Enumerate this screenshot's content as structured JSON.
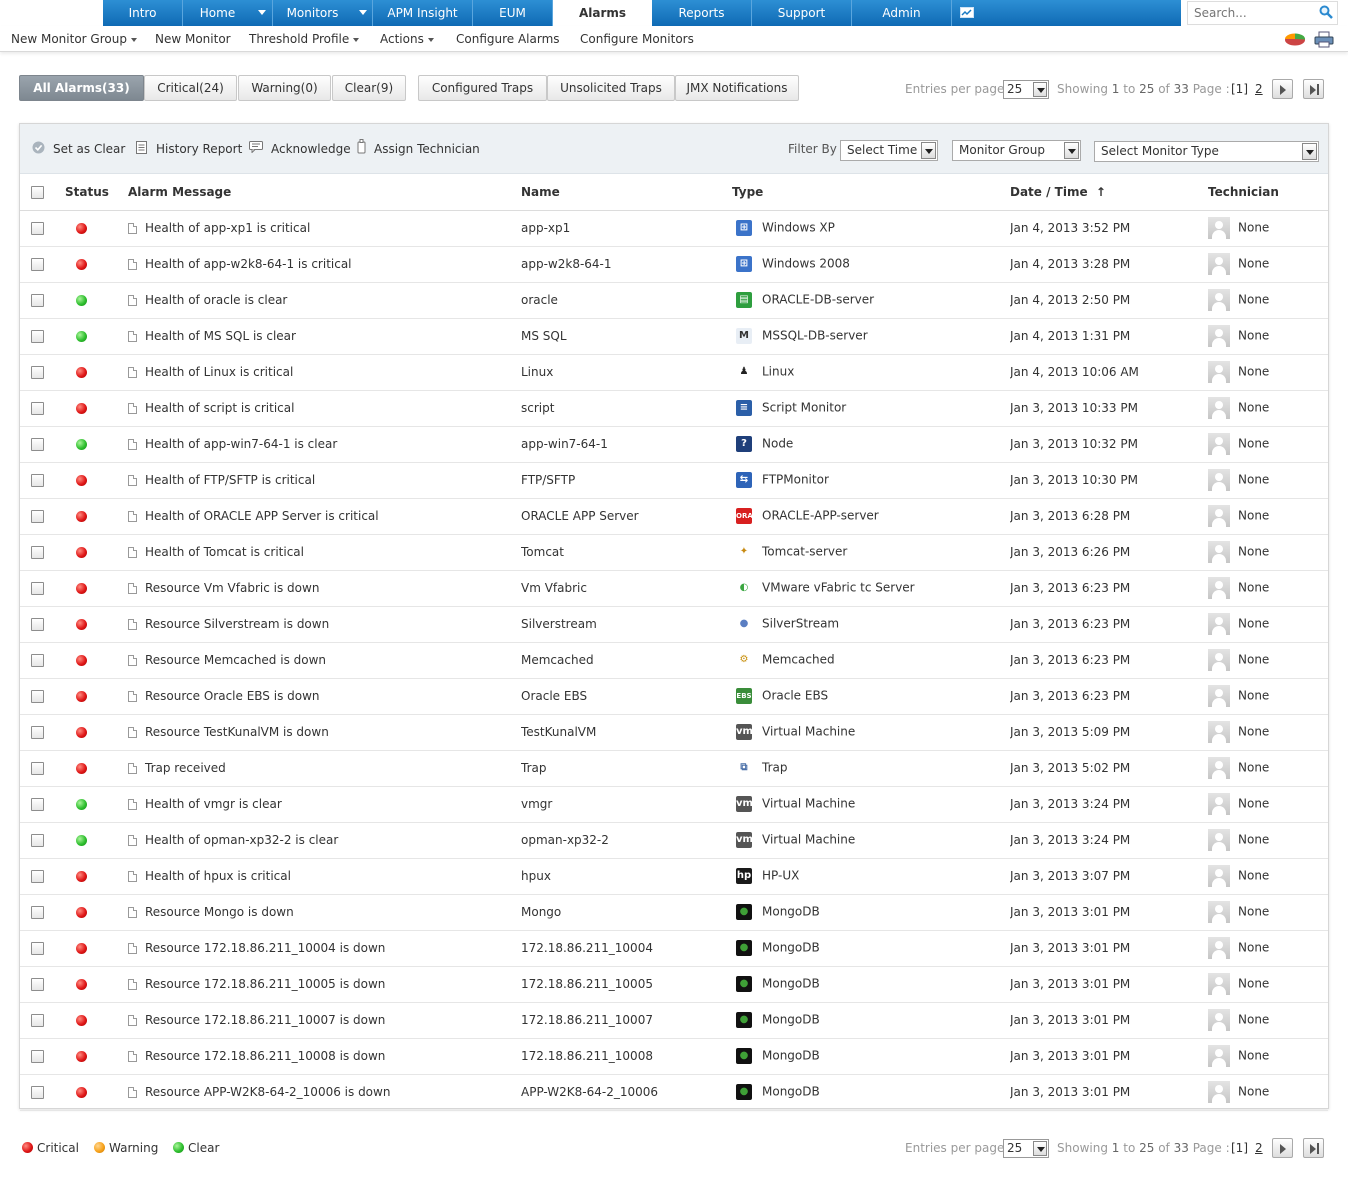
{
  "topnav": {
    "tabs": [
      {
        "label": "Intro"
      },
      {
        "label": "Home"
      },
      {
        "label": "Monitors"
      },
      {
        "label": "APM Insight"
      },
      {
        "label": "EUM"
      },
      {
        "label": "Alarms"
      },
      {
        "label": "Reports"
      },
      {
        "label": "Support"
      },
      {
        "label": "Admin"
      }
    ],
    "active_tab": "Alarms",
    "search_placeholder": "Search...",
    "accent_color": "#1a7ac4"
  },
  "subnav": {
    "items": [
      {
        "label": "New Monitor Group"
      },
      {
        "label": "New Monitor"
      },
      {
        "label": "Threshold Profile"
      },
      {
        "label": "Actions"
      },
      {
        "label": "Configure Alarms"
      },
      {
        "label": "Configure Monitors"
      }
    ]
  },
  "filter_tabs": [
    {
      "label": "All Alarms(33)"
    },
    {
      "label": "Critical(24)"
    },
    {
      "label": "Warning(0)"
    },
    {
      "label": "Clear(9)"
    },
    {
      "label": "Configured Traps"
    },
    {
      "label": "Unsolicited Traps"
    },
    {
      "label": "JMX Notifications"
    }
  ],
  "pagination": {
    "entries_label": "Entries per page",
    "per_page": "25",
    "showing_label": "Showing",
    "from": "1",
    "to_label": "to",
    "to": "25",
    "of_label": "of",
    "total": "33",
    "page_label": "Page :",
    "current_page": "[1]",
    "next_page": "2"
  },
  "toolbar": {
    "set_clear": "Set as Clear",
    "history": "History Report",
    "acknowledge": "Acknowledge",
    "assign": "Assign Technician",
    "filter_by": "Filter By",
    "select_time": "Select Time",
    "monitor_group": "Monitor Group",
    "monitor_type": "Select Monitor Type"
  },
  "table": {
    "headers": {
      "status": "Status",
      "message": "Alarm Message",
      "name": "Name",
      "type": "Type",
      "date": "Date / Time",
      "sort_arrow": "↑",
      "technician": "Technician"
    },
    "rows": [
      {
        "status": "critical",
        "message": "Health of app-xp1 is critical",
        "name": "app-xp1",
        "type": "Windows XP",
        "icon": "windows-icon",
        "date": "Jan 4, 2013 3:52 PM",
        "tech": "None"
      },
      {
        "status": "critical",
        "message": "Health of app-w2k8-64-1 is critical",
        "name": "app-w2k8-64-1",
        "type": "Windows 2008",
        "icon": "windows-icon",
        "date": "Jan 4, 2013 3:28 PM",
        "tech": "None"
      },
      {
        "status": "clear",
        "message": "Health of oracle is clear",
        "name": "oracle",
        "type": "ORACLE-DB-server",
        "icon": "oracle-db-icon",
        "date": "Jan 4, 2013 2:50 PM",
        "tech": "None"
      },
      {
        "status": "clear",
        "message": "Health of MS SQL is clear",
        "name": "MS SQL",
        "type": "MSSQL-DB-server",
        "icon": "mssql-icon",
        "date": "Jan 4, 2013 1:31 PM",
        "tech": "None"
      },
      {
        "status": "critical",
        "message": "Health of Linux is critical",
        "name": "Linux",
        "type": "Linux",
        "icon": "linux-icon",
        "date": "Jan 4, 2013 10:06 AM",
        "tech": "None"
      },
      {
        "status": "critical",
        "message": "Health of script is critical",
        "name": "script",
        "type": "Script Monitor",
        "icon": "script-icon",
        "date": "Jan 3, 2013 10:33 PM",
        "tech": "None"
      },
      {
        "status": "clear",
        "message": "Health of app-win7-64-1 is clear",
        "name": "app-win7-64-1",
        "type": "Node",
        "icon": "node-icon",
        "date": "Jan 3, 2013 10:32 PM",
        "tech": "None"
      },
      {
        "status": "critical",
        "message": "Health of FTP/SFTP is critical",
        "name": "FTP/SFTP",
        "type": "FTPMonitor",
        "icon": "ftp-icon",
        "date": "Jan 3, 2013 10:30 PM",
        "tech": "None"
      },
      {
        "status": "critical",
        "message": "Health of ORACLE APP Server is critical",
        "name": "ORACLE APP Server",
        "type": "ORACLE-APP-server",
        "icon": "oracle-app-icon",
        "date": "Jan 3, 2013 6:28 PM",
        "tech": "None"
      },
      {
        "status": "critical",
        "message": "Health of Tomcat is critical",
        "name": "Tomcat",
        "type": "Tomcat-server",
        "icon": "tomcat-icon",
        "date": "Jan 3, 2013 6:26 PM",
        "tech": "None"
      },
      {
        "status": "critical",
        "message": "Resource Vm Vfabric is down",
        "name": "Vm Vfabric",
        "type": "VMware vFabric tc Server",
        "icon": "vfabric-icon",
        "date": "Jan 3, 2013 6:23 PM",
        "tech": "None"
      },
      {
        "status": "critical",
        "message": "Resource Silverstream is down",
        "name": "Silverstream",
        "type": "SilverStream",
        "icon": "silverstream-icon",
        "date": "Jan 3, 2013 6:23 PM",
        "tech": "None"
      },
      {
        "status": "critical",
        "message": "Resource Memcached is down",
        "name": "Memcached",
        "type": "Memcached",
        "icon": "memcached-icon",
        "date": "Jan 3, 2013 6:23 PM",
        "tech": "None"
      },
      {
        "status": "critical",
        "message": "Resource Oracle EBS is down",
        "name": "Oracle EBS",
        "type": "Oracle EBS",
        "icon": "oracle-ebs-icon",
        "date": "Jan 3, 2013 6:23 PM",
        "tech": "None"
      },
      {
        "status": "critical",
        "message": "Resource TestKunalVM is down",
        "name": "TestKunalVM",
        "type": "Virtual Machine",
        "icon": "vm-icon",
        "date": "Jan 3, 2013 5:09 PM",
        "tech": "None"
      },
      {
        "status": "critical",
        "message": "Trap received",
        "name": "Trap",
        "type": "Trap",
        "icon": "trap-icon",
        "date": "Jan 3, 2013 5:02 PM",
        "tech": "None"
      },
      {
        "status": "clear",
        "message": "Health of vmgr is clear",
        "name": "vmgr",
        "type": "Virtual Machine",
        "icon": "vm-icon",
        "date": "Jan 3, 2013 3:24 PM",
        "tech": "None"
      },
      {
        "status": "clear",
        "message": "Health of opman-xp32-2 is clear",
        "name": "opman-xp32-2",
        "type": "Virtual Machine",
        "icon": "vm-icon",
        "date": "Jan 3, 2013 3:24 PM",
        "tech": "None"
      },
      {
        "status": "critical",
        "message": "Health of hpux is critical",
        "name": "hpux",
        "type": "HP-UX",
        "icon": "hp-icon",
        "date": "Jan 3, 2013 3:07 PM",
        "tech": "None"
      },
      {
        "status": "critical",
        "message": "Resource Mongo is down",
        "name": "Mongo",
        "type": "MongoDB",
        "icon": "mongodb-icon",
        "date": "Jan 3, 2013 3:01 PM",
        "tech": "None"
      },
      {
        "status": "critical",
        "message": "Resource 172.18.86.211_10004 is down",
        "name": "172.18.86.211_10004",
        "type": "MongoDB",
        "icon": "mongodb-icon",
        "date": "Jan 3, 2013 3:01 PM",
        "tech": "None"
      },
      {
        "status": "critical",
        "message": "Resource 172.18.86.211_10005 is down",
        "name": "172.18.86.211_10005",
        "type": "MongoDB",
        "icon": "mongodb-icon",
        "date": "Jan 3, 2013 3:01 PM",
        "tech": "None"
      },
      {
        "status": "critical",
        "message": "Resource 172.18.86.211_10007 is down",
        "name": "172.18.86.211_10007",
        "type": "MongoDB",
        "icon": "mongodb-icon",
        "date": "Jan 3, 2013 3:01 PM",
        "tech": "None"
      },
      {
        "status": "critical",
        "message": "Resource 172.18.86.211_10008 is down",
        "name": "172.18.86.211_10008",
        "type": "MongoDB",
        "icon": "mongodb-icon",
        "date": "Jan 3, 2013 3:01 PM",
        "tech": "None"
      },
      {
        "status": "critical",
        "message": "Resource APP-W2K8-64-2_10006 is down",
        "name": "APP-W2K8-64-2_10006",
        "type": "MongoDB",
        "icon": "mongodb-icon",
        "date": "Jan 3, 2013 3:01 PM",
        "tech": "None"
      }
    ]
  },
  "legend": {
    "critical": "Critical",
    "warning": "Warning",
    "clear": "Clear",
    "critical_color": "#e01818",
    "warning_color": "#f7a21b",
    "clear_color": "#2fbf2f"
  }
}
